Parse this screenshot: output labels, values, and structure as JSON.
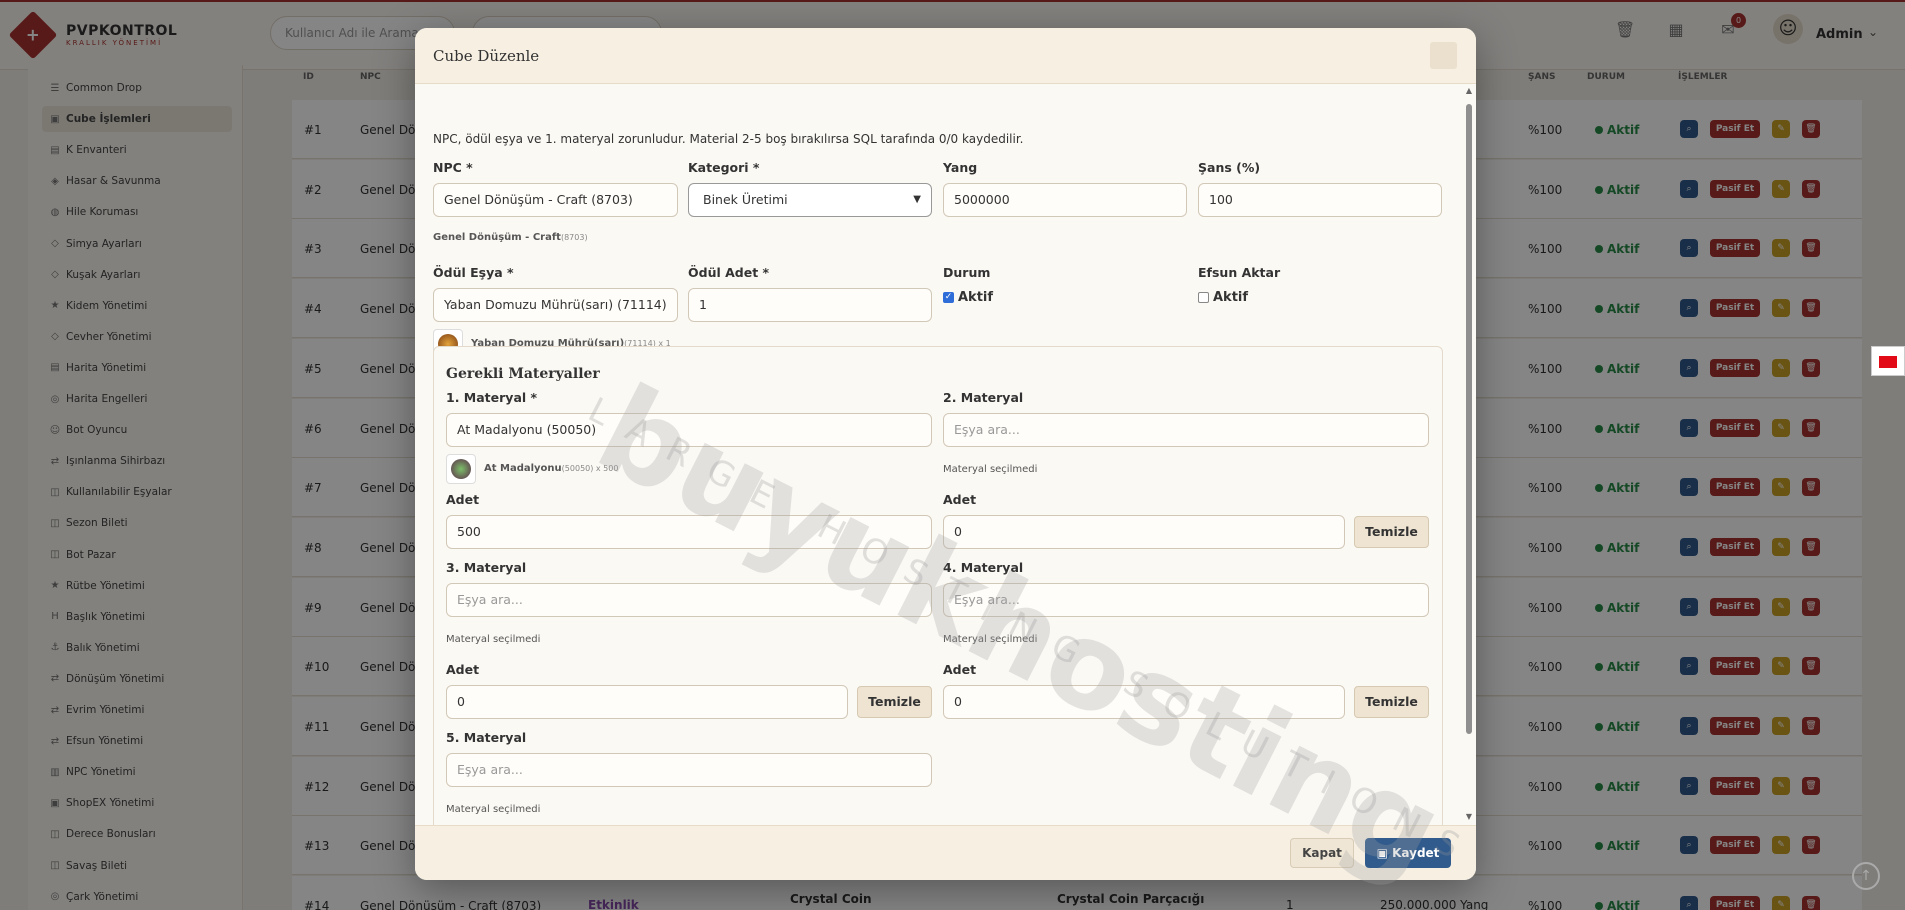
{
  "brand": {
    "title": "PVPKONTROL",
    "subtitle": "KRALLIK YÖNETİMİ"
  },
  "topbar": {
    "search_placeholder": "Kullanıcı Adı ile Arama",
    "notif_count": "0",
    "admin_name": "Admin"
  },
  "sidebar": {
    "items": [
      "Common Drop",
      "Cube İşlemleri",
      "K Envanteri",
      "Hasar & Savunma",
      "Hile Koruması",
      "Simya Ayarları",
      "Kuşak Ayarları",
      "Kidem Yönetimi",
      "Cevher Yönetimi",
      "Harita Yönetimi",
      "Harita Engelleri",
      "Bot Oyuncu",
      "Işınlanma Sihirbazı",
      "Kullanılabilir Eşyalar",
      "Sezon Bileti",
      "Bot Pazar",
      "Rütbe Yönetimi",
      "Başlık Yönetimi",
      "Balık Yönetimi",
      "Dönüşüm Yönetimi",
      "Evrim Yönetimi",
      "Efsun Yönetimi",
      "NPC Yönetimi",
      "ShopEX Yönetimi",
      "Derece Bonusları",
      "Savaş Bileti",
      "Çark Yönetimi"
    ],
    "active_index": 1
  },
  "table": {
    "headers": {
      "id": "ID",
      "npc": "NPC",
      "sans": "ŞANS",
      "durum": "DURUM",
      "islemler": "İŞLEMLER"
    },
    "row_ids": [
      "#1",
      "#2",
      "#3",
      "#4",
      "#5",
      "#6",
      "#7",
      "#8",
      "#9",
      "#10",
      "#11",
      "#12",
      "#13",
      "#14"
    ],
    "npc_text": "Genel Dö",
    "row14_npc": "Genel Dönüşüm - Craft (8703)",
    "row14_category": "Etkinlik",
    "row14_item1": "Crystal Coin",
    "row14_item2": "Crystal Coin Parçacığı",
    "row14_count": "1",
    "row14_yang": "250.000.000 Yang",
    "yang_suffix": "g",
    "chance": "%100",
    "status": "Aktif",
    "pasif_label": "Pasif Et"
  },
  "modal": {
    "title": "Cube Düzenle",
    "info": "NPC, ödül eşya ve 1. materyal zorunludur. Material 2-5 boş bırakılırsa SQL tarafında 0/0 kaydedilir.",
    "npc": {
      "label": "NPC *",
      "value": "Genel Dönüşüm - Craft (8703)",
      "hint_name": "Genel Dönüşüm - Craft",
      "hint_id": "(8703)"
    },
    "kategori": {
      "label": "Kategori *",
      "value": "Binek Üretimi"
    },
    "yang": {
      "label": "Yang",
      "value": "5000000"
    },
    "sans": {
      "label": "Şans (%)",
      "value": "100"
    },
    "odul_esya": {
      "label": "Ödül Eşya *",
      "value": "Yaban Domuzu Mührü(sarı) (71114)",
      "hint_name": "Yaban Domuzu Mührü(sarı)",
      "hint_extra": "(71114) x 1"
    },
    "odul_adet": {
      "label": "Ödül Adet *",
      "value": "1"
    },
    "durum": {
      "label": "Durum",
      "check_label": "Aktif",
      "checked": true
    },
    "efsun": {
      "label": "Efsun Aktar",
      "check_label": "Aktif",
      "checked": false
    },
    "materials_title": "Gerekli Materyaller",
    "m1": {
      "label": "1. Materyal *",
      "value": "At Madalyonu (50050)",
      "hint_name": "At Madalyonu",
      "hint_extra": "(50050) x 500",
      "adet_label": "Adet",
      "adet": "500"
    },
    "m2": {
      "label": "2. Materyal",
      "placeholder": "Eşya ara...",
      "hint": "Materyal seçilmedi",
      "adet_label": "Adet",
      "adet": "0"
    },
    "m3": {
      "label": "3. Materyal",
      "placeholder": "Eşya ara...",
      "hint": "Materyal seçilmedi",
      "adet_label": "Adet",
      "adet": "0"
    },
    "m4": {
      "label": "4. Materyal",
      "placeholder": "Eşya ara...",
      "hint": "Materyal seçilmedi",
      "adet_label": "Adet",
      "adet": "0"
    },
    "m5": {
      "label": "5. Materyal",
      "placeholder": "Eşya ara...",
      "hint": "Materyal seçilmedi"
    },
    "temizle": "Temizle",
    "kapat": "Kapat",
    "kaydet": "Kaydet"
  },
  "watermark": {
    "main": "buyukhosting",
    "sub": "LARGE HOSTING SOLUTIONS"
  },
  "colors": {
    "accent": "#a8332f",
    "primary": "#315b8c",
    "success": "#2a8c4a"
  }
}
